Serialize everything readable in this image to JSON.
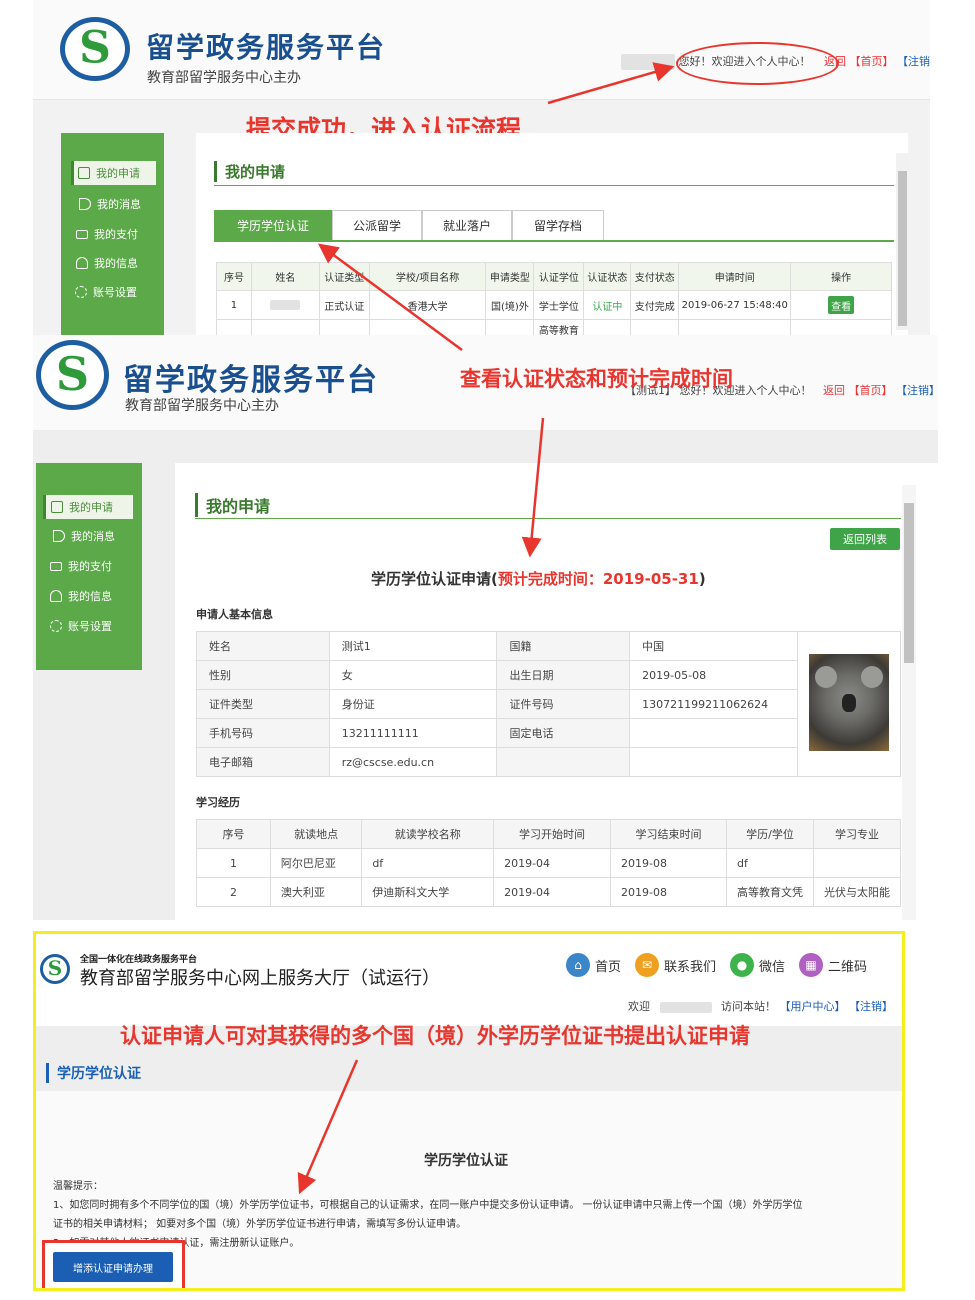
{
  "annotations": {
    "submit_success": "提交成功，进入认证流程",
    "check_status": "查看认证状态和预计完成时间",
    "multi_apply": "认证申请人可对其获得的多个国（境）外学历学位证书提出认证申请"
  },
  "panel1": {
    "brand_title": "留学政务服务平台",
    "brand_subtitle": "教育部留学服务中心主办",
    "greeting": "您好！欢迎进入个人中心！",
    "back_link": "返回",
    "home_link": "【首页】",
    "logout_link": "【注销】",
    "sidebar": [
      "我的申请",
      "我的消息",
      "我的支付",
      "我的信息",
      "账号设置"
    ],
    "section_title": "我的申请",
    "tabs": [
      "学历学位认证",
      "公派留学",
      "就业落户",
      "留学存档"
    ],
    "table_headers": [
      "序号",
      "姓名",
      "认证类型",
      "学校/项目名称",
      "申请类型",
      "认证学位",
      "认证状态",
      "支付状态",
      "申请时间",
      "操作"
    ],
    "row": {
      "no": "1",
      "type": "正式认证",
      "school": "香港大学",
      "apply_type": "国(境)外",
      "degree": "学士学位",
      "status": "认证中",
      "pay_status": "支付完成",
      "time": "2019-06-27 15:48:40",
      "action": "查看"
    },
    "next_row_partial": "高等教育"
  },
  "panel2": {
    "brand_title": "留学政务服务平台",
    "brand_subtitle": "教育部留学服务中心主办",
    "user_tag": "【测试1】",
    "greeting": "您好！欢迎进入个人中心！",
    "back_link": "返回",
    "home_link": "【首页】",
    "logout_link": "【注销】",
    "sidebar": [
      "我的申请",
      "我的消息",
      "我的支付",
      "我的信息",
      "账号设置"
    ],
    "section_title": "我的申请",
    "back_list_button": "返回列表",
    "heading_main": "学历学位认证申请(",
    "heading_estimate": "预计完成时间：2019-05-31",
    "heading_close": ")",
    "basic_info_title": "申请人基本信息",
    "basic_info": [
      [
        "姓名",
        "测试1",
        "国籍",
        "中国"
      ],
      [
        "性别",
        "女",
        "出生日期",
        "2019-05-08"
      ],
      [
        "证件类型",
        "身份证",
        "证件号码",
        "130721199211062624"
      ],
      [
        "手机号码",
        "13211111111",
        "固定电话",
        ""
      ],
      [
        "电子邮箱",
        "rz@cscse.edu.cn",
        "",
        ""
      ]
    ],
    "study_title": "学习经历",
    "study_headers": [
      "序号",
      "就读地点",
      "就读学校名称",
      "学习开始时间",
      "学习结束时间",
      "学历/学位",
      "学习专业"
    ],
    "study_rows": [
      [
        "1",
        "阿尔巴尼亚",
        "df",
        "2019-04",
        "2019-08",
        "df",
        ""
      ],
      [
        "2",
        "澳大利亚",
        "伊迪斯科文大学",
        "2019-04",
        "2019-08",
        "高等教育文凭",
        "光伏与太阳能"
      ]
    ]
  },
  "panel3": {
    "small_title": "全国一体化在线政务服务平台",
    "brand_title": "教育部留学服务中心网上服务大厅（试运行）",
    "nav": [
      {
        "label": "首页",
        "icon": "home-icon",
        "color": "#3b86c9"
      },
      {
        "label": "联系我们",
        "icon": "mail-icon",
        "color": "#f0a020"
      },
      {
        "label": "微信",
        "icon": "wechat-icon",
        "color": "#3cb44b"
      },
      {
        "label": "二维码",
        "icon": "qrcode-icon",
        "color": "#b060c0"
      }
    ],
    "welcome": "欢迎",
    "visit": "访问本站！",
    "user_center": "【用户中心】",
    "logout": "【注销】",
    "section_title": "学历学位认证",
    "content_title": "学历学位认证",
    "tip_title": "温馨提示：",
    "tip_1": "1、如您同时拥有多个不同学位的国（境）外学历学位证书，可根据自己的认证需求，在同一账户中提交多份认证申请。 一份认证申请中只需上传一个国（境）外学历学位",
    "tip_1b": "证书的相关申请材料； 如要对多个国（境）外学历学位证书进行申请，需填写多份认证申请。",
    "tip_2": "2、如需对其他人的证书申请认证，需注册新认证账户。",
    "add_button": "增添认证申请办理"
  },
  "colors": {
    "sidebar_green": "#5ca94a",
    "annotation_red": "#e8362f",
    "brand_blue": "#1a4f8f",
    "highlight_yellow": "#f4ee1e"
  }
}
